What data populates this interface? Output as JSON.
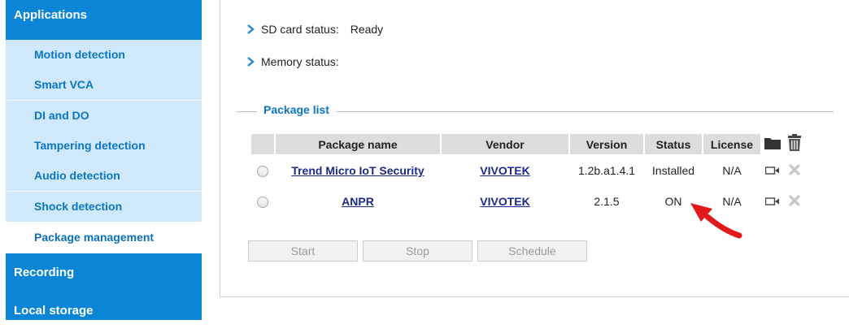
{
  "sidebar": {
    "header_top": "Applications",
    "items": [
      {
        "label": "Motion detection"
      },
      {
        "label": "Smart VCA"
      },
      {
        "label": "DI and DO"
      },
      {
        "label": "Tampering detection"
      },
      {
        "label": "Audio detection"
      },
      {
        "label": "Shock detection"
      },
      {
        "label": "Package management"
      }
    ],
    "header_recording": "Recording",
    "header_storage": "Local storage"
  },
  "status": {
    "sd_label": "SD card status:",
    "sd_value": "Ready",
    "memory_label": "Memory status:",
    "memory_value": ""
  },
  "package_list": {
    "legend": "Package list",
    "columns": [
      "Package name",
      "Vendor",
      "Version",
      "Status",
      "License"
    ],
    "rows": [
      {
        "name": "Trend Micro IoT Security",
        "vendor": "VIVOTEK",
        "version": "1.2b.a1.4.1",
        "status": "Installed",
        "license": "N/A"
      },
      {
        "name": "ANPR",
        "vendor": "VIVOTEK",
        "version": "2.1.5",
        "status": "ON",
        "license": "N/A"
      }
    ]
  },
  "buttons": {
    "start": "Start",
    "stop": "Stop",
    "schedule": "Schedule"
  },
  "colors": {
    "sidebar_header": "#0b86d6",
    "sidebar_sub": "#cfe9fb",
    "link": "#1a2a8c",
    "arrow": "#e01a1a"
  }
}
